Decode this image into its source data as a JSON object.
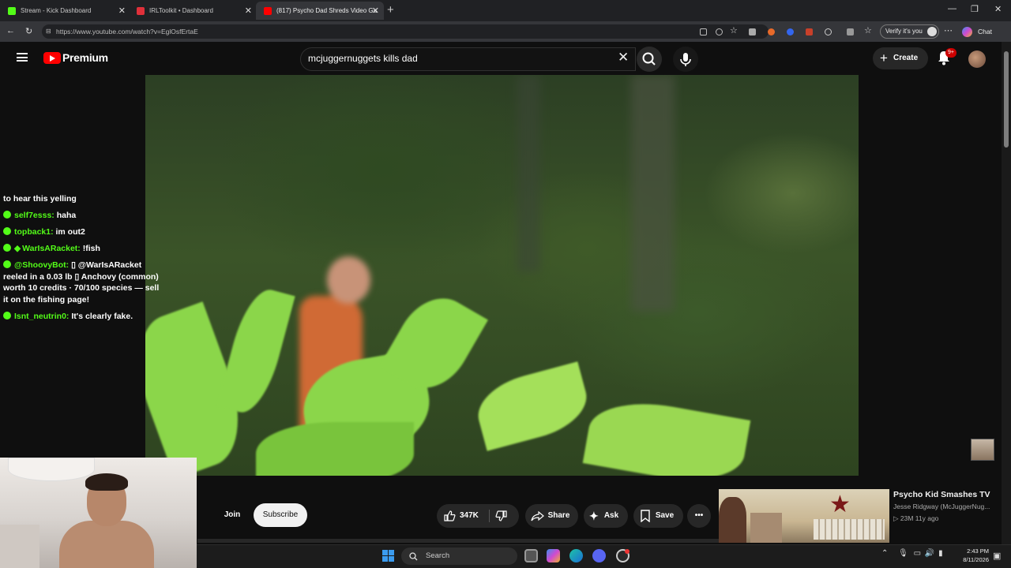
{
  "browser": {
    "tabs": [
      {
        "title": "Stream - Kick Dashboard",
        "favicon_color": "#53fc18",
        "active": false
      },
      {
        "title": "IRLToolkit • Dashboard",
        "favicon_color": "#e0303a",
        "active": false
      },
      {
        "title": "(817) Psycho Dad Shreds Video Ga",
        "favicon_color": "#ff0000",
        "active": true
      }
    ],
    "new_tab_icon": "plus-icon",
    "url": "https://www.youtube.com/watch?v=EglOsfErtaE",
    "verify_label": "Verify it's you",
    "chat_label": "Chat"
  },
  "youtube": {
    "brand": "Premium",
    "search_query": "mcjuggernuggets kills dad",
    "create_label": "Create",
    "notification_count": "9+",
    "accent_color": "#ff0000"
  },
  "chat": {
    "partial_line": "to hear this yelling",
    "messages": [
      {
        "user": "self7esss:",
        "text": "haha",
        "diamond": false
      },
      {
        "user": "topback1:",
        "text": "im out2",
        "diamond": false
      },
      {
        "user": "WarIsARacket:",
        "text": "!fish",
        "diamond": true
      },
      {
        "user": "@ShoovyBot:",
        "text": "▯ @WarIsARacket reeled in a 0.03 lb ▯ Anchovy (common) worth 10 credits · 70/100 species — sell it on the fishing page!",
        "diamond": false
      },
      {
        "user": "Isnt_neutrin0:",
        "text": "It's clearly fake.",
        "diamond": false
      }
    ],
    "user_color": "#53fc18"
  },
  "video_actions": {
    "join_label": "Join",
    "subscribe_label": "Subscribe",
    "like_count": "347K",
    "share_label": "Share",
    "ask_label": "Ask",
    "save_label": "Save"
  },
  "recommended": {
    "title": "Psycho Kid Smashes TV",
    "channel": "Jesse Ridgway (McJuggerNug...",
    "meta": "▷ 23M  11y ago"
  },
  "taskbar": {
    "search_label": "Search",
    "time": "2:43 PM",
    "date": "8/11/2026"
  }
}
